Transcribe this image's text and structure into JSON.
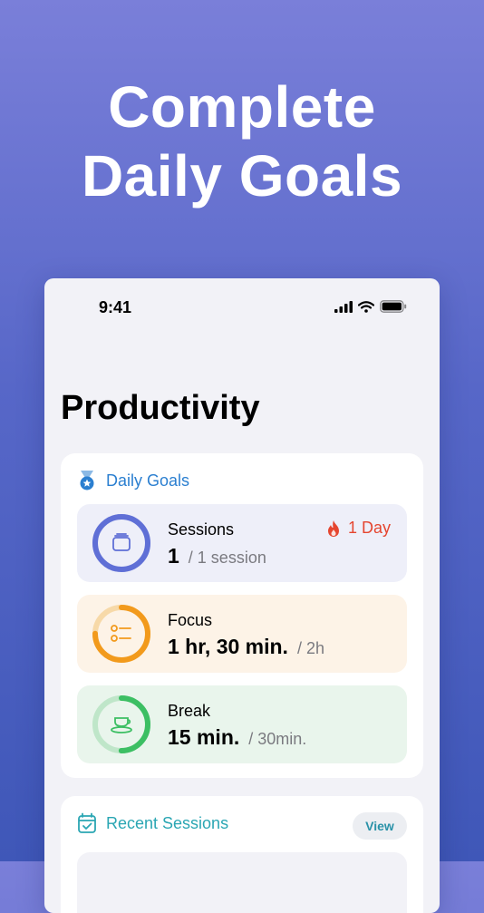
{
  "headline": {
    "line1": "Complete",
    "line2": "Daily Goals"
  },
  "status_bar": {
    "time": "9:41"
  },
  "page": {
    "title": "Productivity"
  },
  "daily_goals": {
    "label": "Daily Goals",
    "goals": [
      {
        "name": "Sessions",
        "value": "1",
        "target": "/ 1 session",
        "progress": 1.0,
        "color": "#5f6fd6",
        "track": "#c9cdef"
      },
      {
        "name": "Focus",
        "value": "1 hr, 30 min.",
        "target": "/ 2h",
        "progress": 0.75,
        "color": "#f29a1c",
        "track": "#f7d9a8"
      },
      {
        "name": "Break",
        "value": "15 min.",
        "target": "/ 30min.",
        "progress": 0.5,
        "color": "#3cbf63",
        "track": "#bfe6c9"
      }
    ],
    "streak": {
      "label": "1 Day",
      "icon": "flame-icon"
    }
  },
  "recent_sessions": {
    "label": "Recent Sessions",
    "view_label": "View"
  },
  "colors": {
    "accent_blue": "#2b7fd0",
    "accent_teal": "#2aa6b3",
    "streak_red": "#e5452f"
  }
}
